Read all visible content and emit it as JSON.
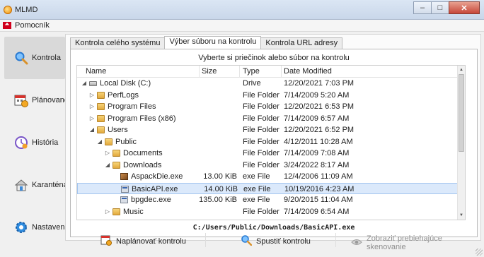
{
  "window": {
    "title": "MLMD"
  },
  "menu": {
    "help_label": "Pomocník"
  },
  "sidebar": {
    "items": [
      {
        "label": "Kontrola",
        "icon": "magnifier-icon",
        "active": true
      },
      {
        "label": "Plánované",
        "icon": "calendar-icon",
        "active": false
      },
      {
        "label": "História",
        "icon": "history-clock-icon",
        "active": false
      },
      {
        "label": "Karanténa",
        "icon": "quarantine-house-icon",
        "active": false
      },
      {
        "label": "Nastavenia",
        "icon": "gear-icon",
        "active": false
      }
    ]
  },
  "tabs": [
    {
      "label": "Kontrola celého systému",
      "active": false
    },
    {
      "label": "Výber súboru na kontrolu",
      "active": true
    },
    {
      "label": "Kontrola URL adresy",
      "active": false
    }
  ],
  "hint": "Vyberte si priečinok alebo súbor na kontrolu",
  "table": {
    "columns": {
      "name": "Name",
      "size": "Size",
      "type": "Type",
      "modified": "Date Modified"
    },
    "rows": [
      {
        "name": "Local Disk (C:)",
        "size": "",
        "type": "Drive",
        "modified": "12/20/2021 7:03 PM",
        "icon": "drive-icon",
        "depth": 0,
        "expander": "expanded"
      },
      {
        "name": "PerfLogs",
        "size": "",
        "type": "File Folder",
        "modified": "7/14/2009 5:20 AM",
        "icon": "folder-icon",
        "depth": 1,
        "expander": "collapsed"
      },
      {
        "name": "Program Files",
        "size": "",
        "type": "File Folder",
        "modified": "12/20/2021 6:53 PM",
        "icon": "folder-icon",
        "depth": 1,
        "expander": "collapsed"
      },
      {
        "name": "Program Files (x86)",
        "size": "",
        "type": "File Folder",
        "modified": "7/14/2009 6:57 AM",
        "icon": "folder-icon",
        "depth": 1,
        "expander": "collapsed"
      },
      {
        "name": "Users",
        "size": "",
        "type": "File Folder",
        "modified": "12/20/2021 6:52 PM",
        "icon": "folder-icon",
        "depth": 1,
        "expander": "expanded"
      },
      {
        "name": "Public",
        "size": "",
        "type": "File Folder",
        "modified": "4/12/2011 10:28 AM",
        "icon": "folder-icon",
        "depth": 2,
        "expander": "expanded"
      },
      {
        "name": "Documents",
        "size": "",
        "type": "File Folder",
        "modified": "7/14/2009 7:08 AM",
        "icon": "folder-icon",
        "depth": 3,
        "expander": "collapsed"
      },
      {
        "name": "Downloads",
        "size": "",
        "type": "File Folder",
        "modified": "3/24/2022 8:17 AM",
        "icon": "folder-icon",
        "depth": 3,
        "expander": "expanded"
      },
      {
        "name": "AspackDie.exe",
        "size": "13.00 KiB",
        "type": "exe File",
        "modified": "12/4/2006 11:09 AM",
        "icon": "package-icon",
        "depth": 4,
        "expander": "none"
      },
      {
        "name": "BasicAPI.exe",
        "size": "14.00 KiB",
        "type": "exe File",
        "modified": "10/19/2016 4:23 AM",
        "icon": "exe-icon",
        "depth": 4,
        "expander": "none",
        "selected": true
      },
      {
        "name": "bpgdec.exe",
        "size": "135.00 KiB",
        "type": "exe File",
        "modified": "9/20/2015 11:04 AM",
        "icon": "exe-icon",
        "depth": 4,
        "expander": "none"
      },
      {
        "name": "Music",
        "size": "",
        "type": "File Folder",
        "modified": "7/14/2009 6:54 AM",
        "icon": "folder-icon",
        "depth": 3,
        "expander": "collapsed"
      }
    ]
  },
  "selected_path": "C:/Users/Public/Downloads/BasicAPI.exe",
  "actions": {
    "schedule_label": "Naplánovať kontrolu",
    "scan_label": "Spustiť kontrolu",
    "show_running_label": "Zobraziť prebiehajúce skenovanie"
  }
}
